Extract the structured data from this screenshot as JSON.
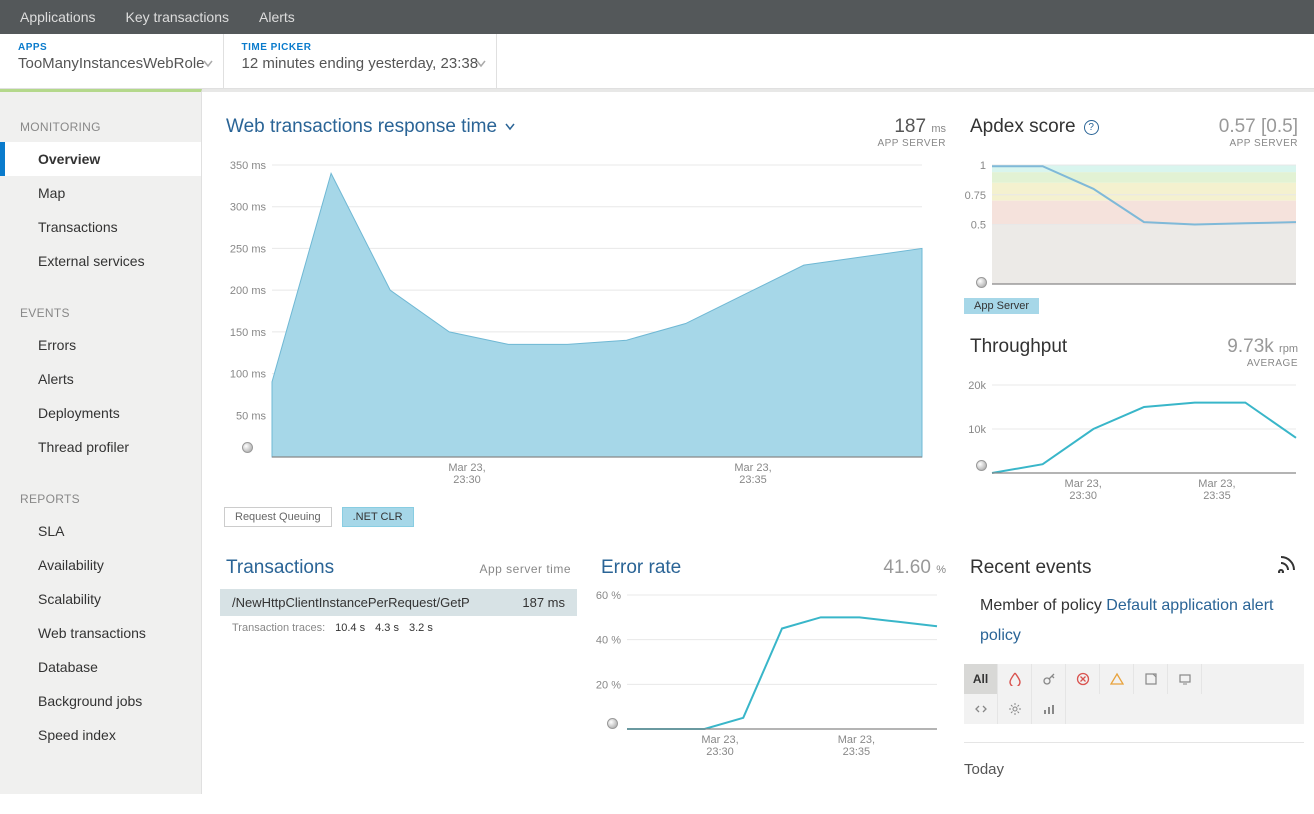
{
  "topnav": [
    "Applications",
    "Key transactions",
    "Alerts"
  ],
  "breadcrumb": {
    "apps_label": "APPS",
    "app_name": "TooManyInstancesWebRole",
    "time_label": "TIME PICKER",
    "time_value": "12 minutes ending yesterday, 23:38"
  },
  "sidebar": {
    "groups": [
      {
        "head": "MONITORING",
        "items": [
          "Overview",
          "Map",
          "Transactions",
          "External services"
        ],
        "active": 0
      },
      {
        "head": "EVENTS",
        "items": [
          "Errors",
          "Alerts",
          "Deployments",
          "Thread profiler"
        ]
      },
      {
        "head": "REPORTS",
        "items": [
          "SLA",
          "Availability",
          "Scalability",
          "Web transactions",
          "Database",
          "Background jobs",
          "Speed index"
        ]
      }
    ]
  },
  "response": {
    "title": "Web transactions response time",
    "value": "187",
    "unit": "ms",
    "sub": "APP SERVER"
  },
  "legend": {
    "req": "Request Queuing",
    "clr": ".NET CLR"
  },
  "apdex": {
    "title": "Apdex score",
    "value": "0.57 [0.5]",
    "sub": "APP SERVER",
    "band": "App Server"
  },
  "throughput": {
    "title": "Throughput",
    "value": "9.73k",
    "unit": "rpm",
    "sub": "AVERAGE"
  },
  "tx": {
    "title": "Transactions",
    "sub": "App server time",
    "row_name": "/NewHttpClientInstancePerRequest/GetP",
    "row_val": "187 ms",
    "traces_label": "Transaction traces:",
    "traces": [
      "10.4 s",
      "4.3 s",
      "3.2 s"
    ]
  },
  "err": {
    "title": "Error rate",
    "value": "41.60",
    "unit": "%"
  },
  "events": {
    "title": "Recent events",
    "policy_prefix": "Member of policy ",
    "policy_link": "Default application alert policy",
    "today": "Today",
    "filters": {
      "all": "All"
    }
  },
  "x_ticks": [
    "Mar 23,\n23:30",
    "Mar 23,\n23:35"
  ],
  "chart_data": [
    {
      "type": "area",
      "title": "Web transactions response time",
      "ylabel": "ms",
      "ylim": [
        0,
        350
      ],
      "yticks": [
        50,
        100,
        150,
        200,
        250,
        300,
        350
      ],
      "x": [
        "23:27",
        "23:28",
        "23:29",
        "23:30",
        "23:31",
        "23:32",
        "23:33",
        "23:34",
        "23:35",
        "23:36",
        "23:37",
        "23:38"
      ],
      "values": [
        90,
        340,
        200,
        150,
        135,
        135,
        140,
        160,
        195,
        230,
        240,
        250
      ],
      "series_name": ".NET CLR"
    },
    {
      "type": "line",
      "title": "Apdex score",
      "ylim": [
        0,
        1
      ],
      "yticks": [
        0.5,
        0.75,
        1
      ],
      "x": [
        "23:27",
        "23:29",
        "23:31",
        "23:33",
        "23:35",
        "23:37",
        "23:38"
      ],
      "values": [
        0.99,
        0.99,
        0.8,
        0.52,
        0.5,
        0.51,
        0.52
      ],
      "bands": [
        [
          0.94,
          1.0,
          "#d9f5ee"
        ],
        [
          0.85,
          0.94,
          "#e2f2d4"
        ],
        [
          0.7,
          0.85,
          "#f4f1cf"
        ],
        [
          0.5,
          0.7,
          "#f5e2dc"
        ],
        [
          0.0,
          0.5,
          "#eceae7"
        ]
      ]
    },
    {
      "type": "line",
      "title": "Throughput",
      "ylabel": "rpm",
      "ylim": [
        0,
        20000
      ],
      "yticks": [
        10000,
        20000
      ],
      "x": [
        "23:27",
        "23:29",
        "23:31",
        "23:33",
        "23:35",
        "23:37",
        "23:38"
      ],
      "values": [
        0,
        2000,
        10000,
        15000,
        16000,
        16000,
        8000
      ]
    },
    {
      "type": "line",
      "title": "Error rate",
      "ylabel": "%",
      "ylim": [
        0,
        60
      ],
      "yticks": [
        20,
        40,
        60
      ],
      "x": [
        "23:27",
        "23:29",
        "23:30",
        "23:31",
        "23:32",
        "23:33",
        "23:35",
        "23:37",
        "23:38"
      ],
      "values": [
        0,
        0,
        0,
        5,
        45,
        50,
        50,
        48,
        46
      ]
    }
  ]
}
